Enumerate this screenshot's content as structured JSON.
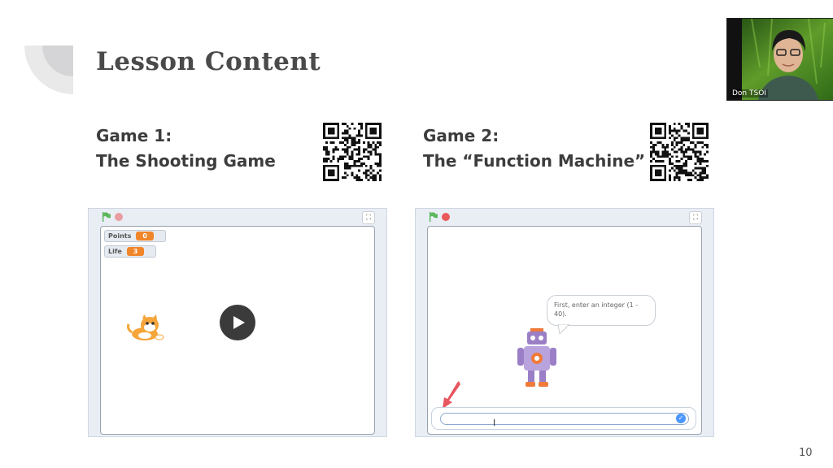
{
  "slide": {
    "title": "Lesson Content",
    "page_number": "10"
  },
  "game1": {
    "line1": "Game 1:",
    "line2": "The Shooting Game",
    "monitors": [
      {
        "label": "Points",
        "value": "0"
      },
      {
        "label": "Life",
        "value": "3"
      }
    ]
  },
  "game2": {
    "line1": "Game 2:",
    "line2": "The “Function Machine”",
    "bubble_text": "First, enter an integer (1 - 40).",
    "answer_value": "",
    "check_glyph": "✓"
  },
  "stage_controls": {
    "fullscreen_glyph": "⛶"
  },
  "webcam": {
    "name": "Don TSOI"
  },
  "colors": {
    "title": "#4a4a4a",
    "monitor_value": "#f0862a",
    "stop": "#e95a5a",
    "play": "#3b3b3b",
    "check": "#4c97ff"
  }
}
